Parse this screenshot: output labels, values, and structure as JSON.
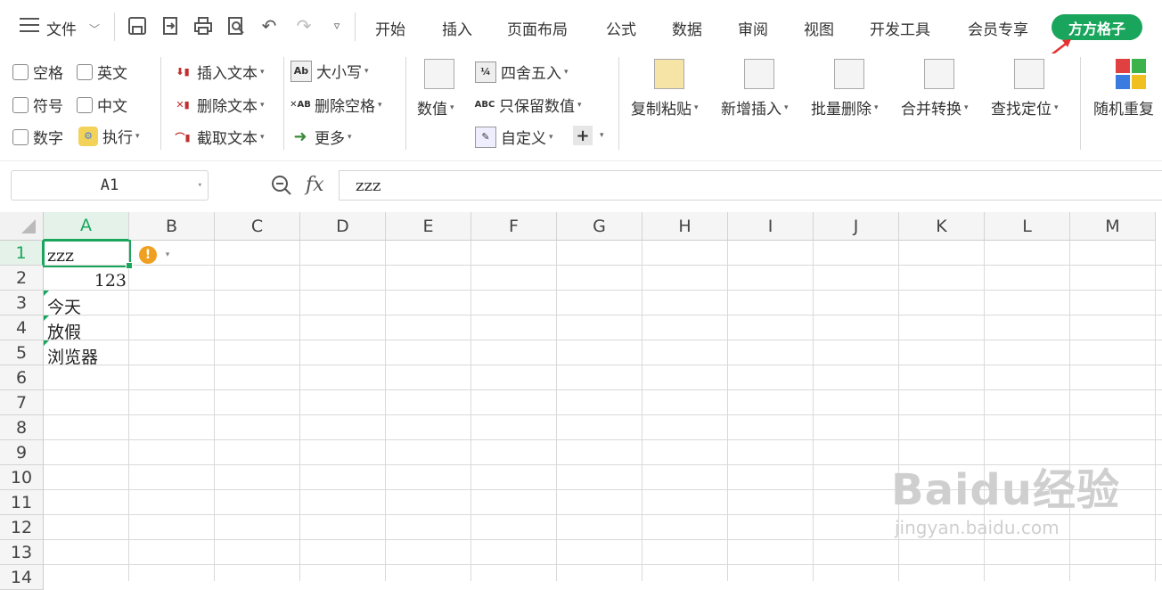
{
  "menubar": {
    "file_label": "文件",
    "tabs": [
      "开始",
      "插入",
      "页面布局",
      "公式",
      "数据",
      "审阅",
      "视图",
      "开发工具",
      "会员专享",
      "方方格子"
    ],
    "quick_icons": [
      "save-icon",
      "export-icon",
      "print-icon",
      "print-preview-icon",
      "undo-icon",
      "redo-icon",
      "more-icon"
    ],
    "active_tab_color": "#1aa55c"
  },
  "ribbon": {
    "checkboxes": [
      [
        "空格",
        "英文"
      ],
      [
        "符号",
        "中文"
      ],
      [
        "数字"
      ]
    ],
    "execute_label": "执行",
    "text_ops": [
      "插入文本",
      "删除文本",
      "截取文本"
    ],
    "case_ops": [
      "大小写",
      "删除空格",
      "更多"
    ],
    "number_label": "数值",
    "num_ops": [
      "四舍五入",
      "只保留数值",
      "自定义"
    ],
    "big_buttons": [
      "复制粘贴",
      "新增插入",
      "批量删除",
      "合并转换",
      "查找定位",
      "随机重复"
    ]
  },
  "formula": {
    "name_box": "A1",
    "fx_label": "fx",
    "content": "zzz"
  },
  "sheet": {
    "columns": [
      "A",
      "B",
      "C",
      "D",
      "E",
      "F",
      "G",
      "H",
      "I",
      "J",
      "K",
      "L",
      "M"
    ],
    "rows": [
      "1",
      "2",
      "3",
      "4",
      "5",
      "6",
      "7",
      "8",
      "9",
      "10",
      "11",
      "12",
      "13",
      "14"
    ],
    "cells": {
      "A1": "zzz",
      "A2": "123",
      "A3": "今天",
      "A4": "放假",
      "A5": "浏览器"
    }
  },
  "watermark": {
    "text": "Baidu经验",
    "url": "jingyan.baidu.com"
  }
}
